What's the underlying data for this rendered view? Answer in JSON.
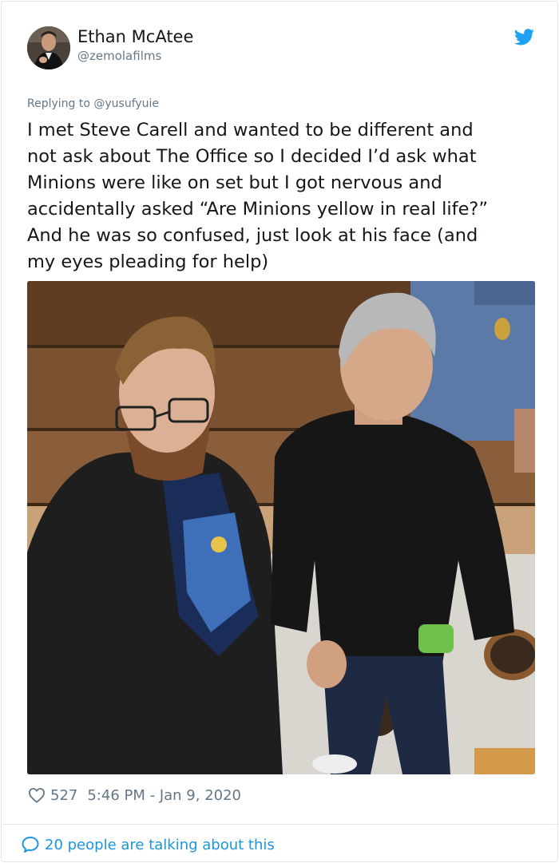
{
  "tweet": {
    "display_name": "Ethan McAtee",
    "handle": "@zemolafilms",
    "replying_to": "Replying to @yusufyuie",
    "text": "I met Steve Carell and wanted to be different and\nnot ask about The Office so I decided I’d ask what\nMinions were like on set but I got nervous and\naccidentally asked “Are Minions yellow in real life?”\nAnd he was so confused, just look at his face (and\nmy eyes pleading for help)",
    "likes": "527",
    "timestamp": "5:46 PM - Jan 9, 2020",
    "conversation": "20 people are talking about this"
  },
  "icons": {
    "brand": "twitter-bird-icon",
    "like": "heart-icon",
    "reply": "speech-bubble-icon"
  },
  "colors": {
    "brand_blue": "#1da1f2",
    "link_blue": "#1b95e0",
    "secondary_text": "#657786",
    "primary_text": "#14171a",
    "border": "#e1e8ed"
  }
}
